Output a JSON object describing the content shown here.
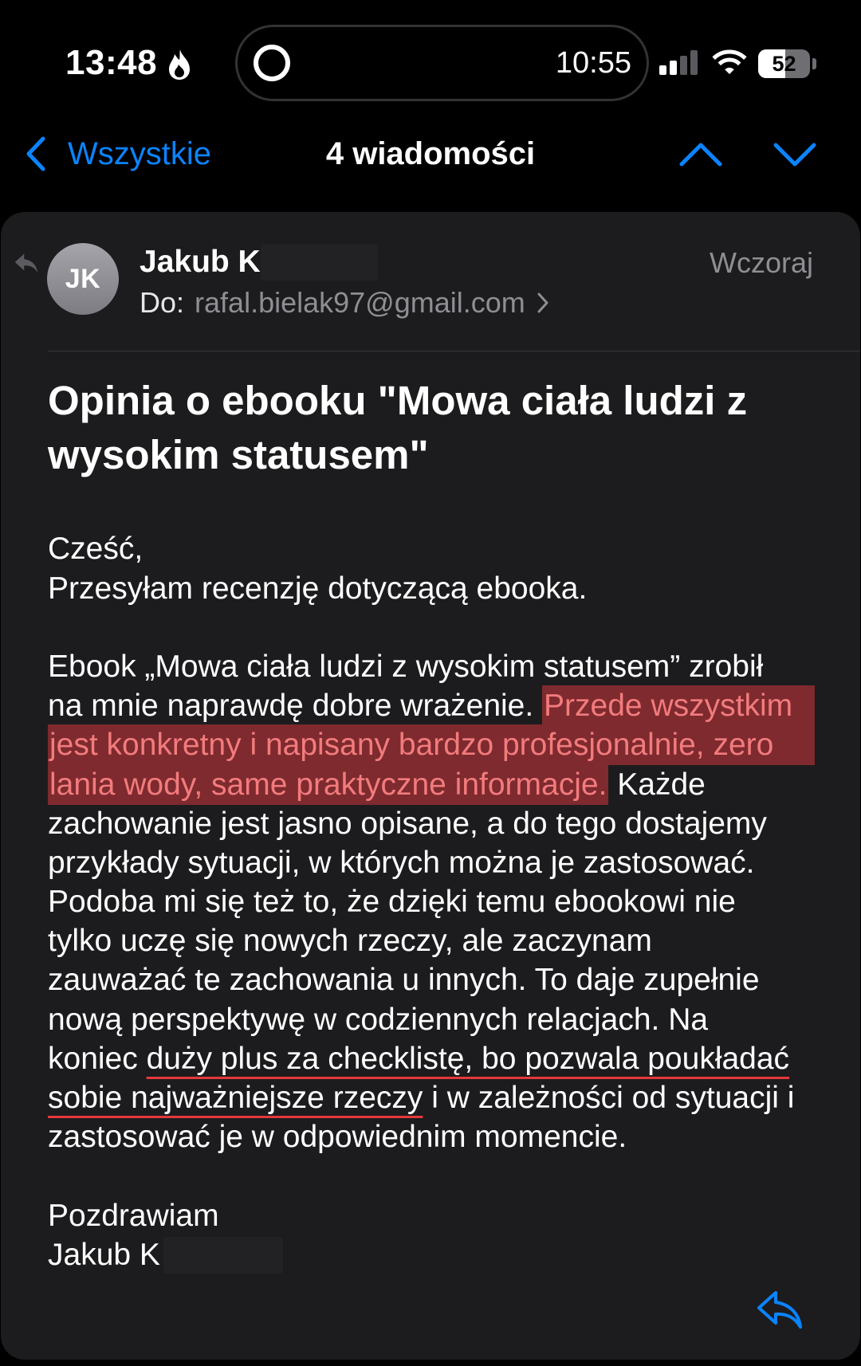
{
  "status_bar": {
    "time": "13:48",
    "island_time": "10:55",
    "battery_level": "52",
    "signal": {
      "active_bars": 2,
      "total_bars": 4
    }
  },
  "nav": {
    "back_label": "Wszystkie",
    "title": "4 wiadomości"
  },
  "message": {
    "avatar_initials": "JK",
    "sender": "Jakub K",
    "to_label": "Do:",
    "to_address": "rafal.bielak97@gmail.com",
    "date": "Wczoraj",
    "subject": "Opinia o ebooku \"Mowa ciała ludzi z wysokim statusem\"",
    "body_lines": [
      [
        {
          "text": "Cześć,"
        }
      ],
      [
        {
          "text": "Przesyłam recenzję dotyczącą ebooka."
        }
      ],
      [],
      [
        {
          "text": "Ebook „Mowa ciała ludzi z wysokim statusem” zrobił"
        }
      ],
      [
        {
          "text": "na mnie naprawdę dobre wrażenie. "
        },
        {
          "text": "Przede wszystkim",
          "highlighted": true
        }
      ],
      [
        {
          "text": "jest konkretny i napisany bardzo profesjonalnie, zero",
          "highlighted": true
        }
      ],
      [
        {
          "text": "lania wody, same praktyczne informacje.",
          "highlighted": true
        },
        {
          "text": " Każde"
        }
      ],
      [
        {
          "text": "zachowanie jest jasno opisane, a do tego dostajemy"
        }
      ],
      [
        {
          "text": "przykłady sytuacji, w których można je zastosować."
        }
      ],
      [
        {
          "text": "Podoba mi się też to, że dzięki temu ebookowi nie"
        }
      ],
      [
        {
          "text": "tylko uczę się nowych rzeczy, ale zaczynam"
        }
      ],
      [
        {
          "text": "zauważać te zachowania u innych. To daje zupełnie"
        }
      ],
      [
        {
          "text": "nową perspektywę w codziennych relacjach. Na"
        }
      ],
      [
        {
          "text": "koniec "
        },
        {
          "text": "duży plus za checklistę, bo pozwala poukładać",
          "underlined": true
        }
      ],
      [
        {
          "text": "sobie najważniejsze rzeczy",
          "underlined": true
        },
        {
          "text": " i w zależności od sytuacji i"
        }
      ],
      [
        {
          "text": "zastosować je w odpowiednim momencie."
        }
      ]
    ],
    "signature": {
      "greeting": "Pozdrawiam",
      "name": "Jakub K"
    }
  },
  "icons": {
    "status_bar": [
      "flame-icon",
      "dynamic-island-ring-icon",
      "signal-bars-icon",
      "wifi-icon",
      "battery-icon"
    ],
    "nav": [
      "chevron-left-icon",
      "chevron-up-icon",
      "chevron-down-icon"
    ],
    "message": [
      "replied-indicator-icon",
      "chevron-right-icon",
      "reply-icon"
    ]
  },
  "colors": {
    "background": "#000000",
    "card": "#1c1c1e",
    "accent": "#0a84ff",
    "text": "#ffffff",
    "secondary_text": "#8e8e93",
    "highlight_background": "#7e2a2e",
    "highlight_text": "#f27b7d",
    "underline": "#e5383b"
  }
}
